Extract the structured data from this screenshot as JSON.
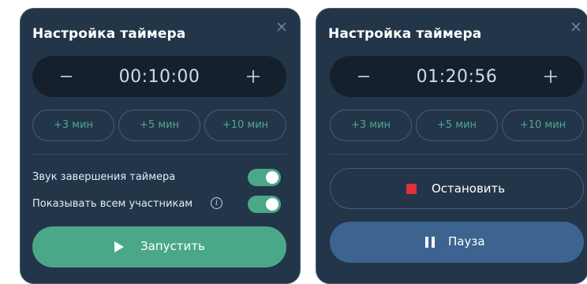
{
  "panel_left": {
    "title": "Настройка таймера",
    "time": "00:10:00",
    "quick_add": [
      "+3 мин",
      "+5 мин",
      "+10 мин"
    ],
    "settings": [
      {
        "label": "Звук завершения таймера",
        "enabled": true
      },
      {
        "label": "Показывать всем участникам",
        "enabled": true,
        "has_info": true
      }
    ],
    "start_label": "Запустить"
  },
  "panel_right": {
    "title": "Настройка таймера",
    "time": "01:20:56",
    "quick_add": [
      "+3 мин",
      "+5 мин",
      "+10 мин"
    ],
    "stop_label": "Остановить",
    "pause_label": "Пауза"
  },
  "icons": {
    "close": "close-icon",
    "minus": "minus-icon",
    "plus": "plus-icon",
    "play": "play-icon",
    "stop": "stop-icon",
    "pause": "pause-icon",
    "info": "info-icon"
  },
  "colors": {
    "panel_bg": "#233549",
    "timebar_bg": "#16202d",
    "accent_green": "#4aa889",
    "chip_text": "#4fa892",
    "pause_blue": "#3d6491",
    "stop_red": "#e0303a"
  }
}
